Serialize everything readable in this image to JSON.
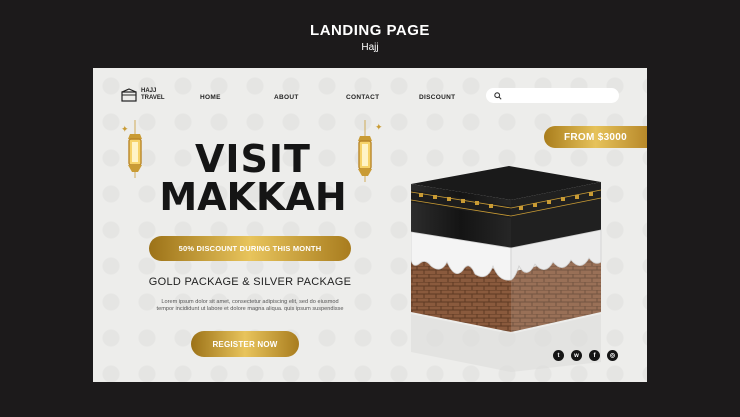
{
  "page": {
    "title": "LANDING PAGE",
    "subtitle": "Hajj"
  },
  "logo": {
    "line1": "HAJJ",
    "line2": "TRAVEL"
  },
  "nav": {
    "home": "HOME",
    "about": "ABOUT",
    "contact": "CONTACT",
    "discount": "DISCOUNT"
  },
  "search": {
    "placeholder": "",
    "icon": "search-icon"
  },
  "price_tag": "FROM $3000",
  "hero": {
    "line1": "VISIT",
    "line2": "MAKKAH",
    "discount": "50% DISCOUNT DURING THIS MONTH",
    "packages": "GOLD PACKAGE & SILVER PACKAGE",
    "lorem_line1": "Lorem ipsum dolor sit amet, consectetur adipiscing elit, sed do eiusmod",
    "lorem_line2": "tempor incididunt ut labore et dolore magna aliqua. quis ipsum suspendisse",
    "register": "REGISTER NOW"
  },
  "social": {
    "twitter": "t",
    "whatsapp": "w",
    "facebook": "f",
    "instagram": "◎"
  },
  "colors": {
    "gold": "#d4a93f",
    "dark": "#1c1a1b",
    "card": "#ededeb"
  }
}
